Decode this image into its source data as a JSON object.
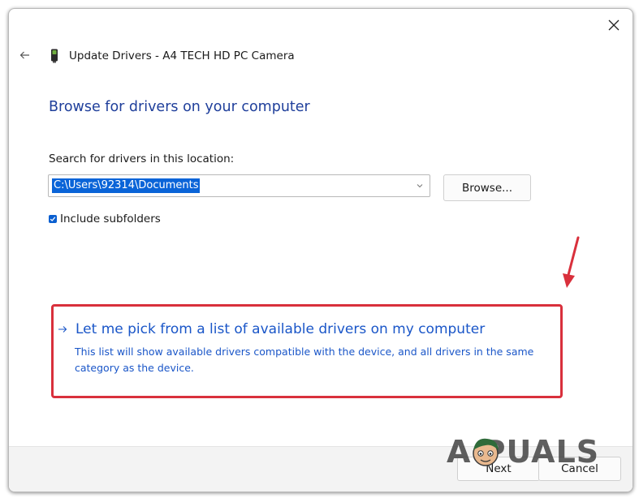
{
  "window": {
    "title": "Update Drivers - A4 TECH HD PC Camera",
    "icons": {
      "close": "close-icon",
      "back": "back-arrow-icon",
      "device": "camera-device-icon"
    }
  },
  "main": {
    "heading": "Browse for drivers on your computer",
    "search_label": "Search for drivers in this location:",
    "path_value": "C:\\Users\\92314\\Documents",
    "browse_label": "Browse...",
    "include_subfolders_label": "Include subfolders",
    "include_subfolders_checked": true
  },
  "pick_option": {
    "title": "Let me pick from a list of available drivers on my computer",
    "description": "This list will show available drivers compatible with the device, and all drivers in the same category as the device.",
    "icon": "right-arrow-icon",
    "highlight_color": "#d9303c"
  },
  "footer": {
    "next_label": "Next",
    "cancel_label": "Cancel"
  },
  "watermark": {
    "text": "A PUALS"
  },
  "colors": {
    "heading": "#1f3f9b",
    "link": "#1a56c8",
    "selection": "#0a64d8",
    "annotation": "#d9303c"
  }
}
